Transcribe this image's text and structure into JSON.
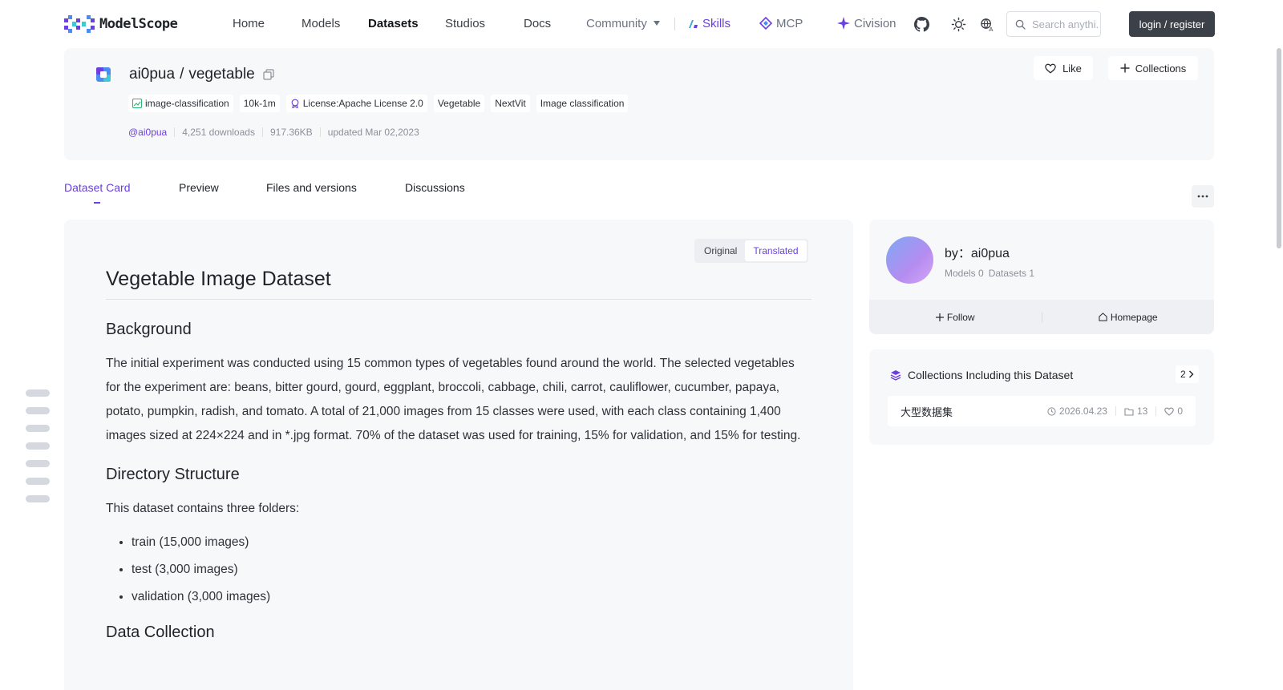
{
  "nav": {
    "logo_text": "ModelScope",
    "items": [
      "Home",
      "Models",
      "Datasets",
      "Studios",
      "Docs",
      "Community"
    ],
    "skills_label": "Skills",
    "mcp_label": "MCP",
    "civision_label": "Civision",
    "search_placeholder": "Search anythi...",
    "login_label": "login / register"
  },
  "dataset": {
    "owner": "ai0pua",
    "slash": "/",
    "name": "vegetable",
    "like_label": "Like",
    "collections_label": "Collections",
    "tags": [
      "image-classification",
      "10k-1m",
      "License:Apache License 2.0",
      "Vegetable",
      "NextVit",
      "Image classification"
    ],
    "user_link": "@ai0pua",
    "downloads": "4,251 downloads",
    "size": "917.36KB",
    "updated": "updated Mar 02,2023"
  },
  "tabs": [
    "Dataset Card",
    "Preview",
    "Files and versions",
    "Discussions"
  ],
  "toggle": {
    "original": "Original",
    "translated": "Translated"
  },
  "doc": {
    "title": "Vegetable Image Dataset",
    "background_heading": "Background",
    "background_text": "The initial experiment was conducted using 15 common types of vegetables found around the world. The selected vegetables for the experiment are: beans, bitter gourd, gourd, eggplant, broccoli, cabbage, chili, carrot, cauliflower, cucumber, papaya, potato, pumpkin, radish, and tomato. A total of 21,000 images from 15 classes were used, with each class containing 1,400 images sized at 224×224 and in *.jpg format. 70% of the dataset was used for training, 15% for validation, and 15% for testing.",
    "structure_heading": "Directory Structure",
    "structure_text": "This dataset contains three folders:",
    "folders": [
      "train (15,000 images)",
      "test (3,000 images)",
      "validation (3,000 images)"
    ],
    "collection_heading": "Data Collection"
  },
  "author": {
    "by_label": "by：ai0pua",
    "models": "Models 0",
    "datasets": "Datasets 1",
    "follow_label": "Follow",
    "homepage_label": "Homepage"
  },
  "collections": {
    "heading": "Collections Including this Dataset",
    "count": "2",
    "item": {
      "name": "大型数据集",
      "date": "2026.04.23",
      "items": "13",
      "likes": "0"
    }
  },
  "colors": {
    "accent": "#6b3fe0",
    "login_bg": "#3b4049",
    "card_bg": "#f7f8fa"
  },
  "icons": [
    "github-icon",
    "theme-icon",
    "language-icon",
    "search-icon",
    "heart-icon",
    "plus-icon",
    "copy-icon",
    "more-icon",
    "clock-icon",
    "folder-icon"
  ]
}
